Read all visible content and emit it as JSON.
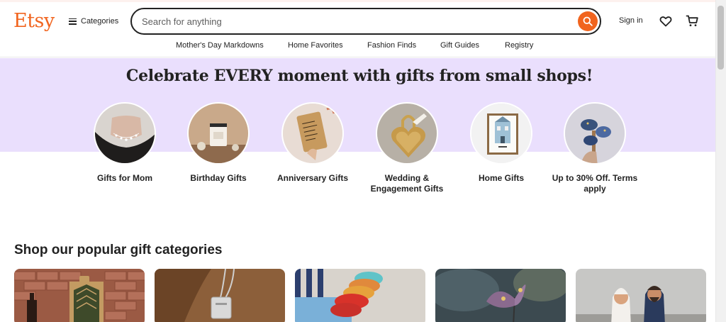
{
  "brand": {
    "logo": "Etsy",
    "accent": "#f1641e"
  },
  "header": {
    "categories_label": "Categories",
    "search_placeholder": "Search for anything",
    "search_value": "",
    "signin_label": "Sign in",
    "icons": [
      "menu-icon",
      "search-icon",
      "heart-icon",
      "cart-icon"
    ]
  },
  "subnav": [
    {
      "label": "Mother's Day Markdowns"
    },
    {
      "label": "Home Favorites"
    },
    {
      "label": "Fashion Finds"
    },
    {
      "label": "Gift Guides"
    },
    {
      "label": "Registry"
    }
  ],
  "hero": {
    "title": "Celebrate EVERY moment with gifts from small shops!",
    "background": "#eadffd",
    "items": [
      {
        "label": "Gifts for Mom"
      },
      {
        "label": "Birthday Gifts"
      },
      {
        "label": "Anniversary Gifts"
      },
      {
        "label": "Wedding & Engagement Gifts"
      },
      {
        "label": "Home Gifts"
      },
      {
        "label": "Up to 30% Off. Terms apply"
      }
    ]
  },
  "popular": {
    "title": "Shop our popular gift categories",
    "cards": [
      {
        "image": "wine-gift-bag"
      },
      {
        "image": "silver-necklace"
      },
      {
        "image": "colorful-bracelets"
      },
      {
        "image": "butterfly-ornament"
      },
      {
        "image": "couple-figurines"
      }
    ]
  }
}
